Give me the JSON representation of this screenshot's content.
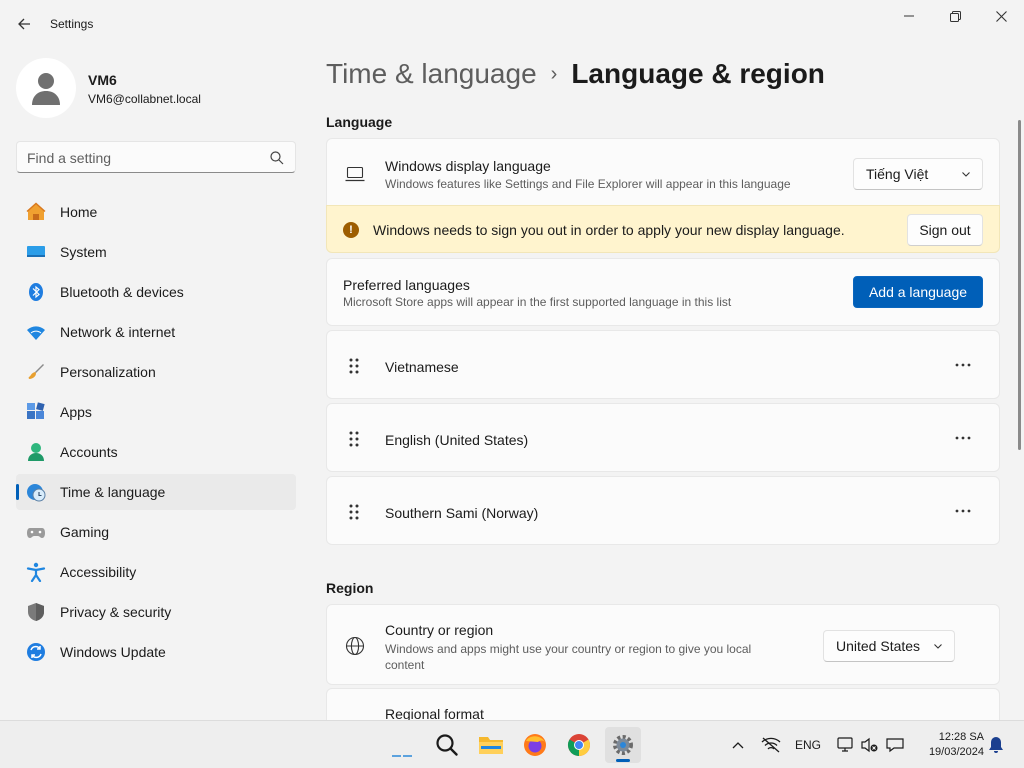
{
  "window": {
    "title": "Settings"
  },
  "profile": {
    "name": "VM6",
    "email": "VM6@collabnet.local"
  },
  "search": {
    "placeholder": "Find a setting"
  },
  "sidebar": {
    "items": [
      {
        "label": "Home",
        "icon": "home-icon"
      },
      {
        "label": "System",
        "icon": "system-icon"
      },
      {
        "label": "Bluetooth & devices",
        "icon": "bluetooth-icon"
      },
      {
        "label": "Network & internet",
        "icon": "wifi-icon"
      },
      {
        "label": "Personalization",
        "icon": "brush-icon"
      },
      {
        "label": "Apps",
        "icon": "apps-icon"
      },
      {
        "label": "Accounts",
        "icon": "accounts-icon"
      },
      {
        "label": "Time & language",
        "icon": "time-language-icon",
        "active": true
      },
      {
        "label": "Gaming",
        "icon": "gamepad-icon"
      },
      {
        "label": "Accessibility",
        "icon": "accessibility-icon"
      },
      {
        "label": "Privacy & security",
        "icon": "shield-icon"
      },
      {
        "label": "Windows Update",
        "icon": "update-icon"
      }
    ]
  },
  "breadcrumb": {
    "parent": "Time & language",
    "current": "Language & region"
  },
  "language": {
    "section_title": "Language",
    "display": {
      "title": "Windows display language",
      "description": "Windows features like Settings and File Explorer will appear in this language",
      "selected": "Tiếng Việt"
    },
    "banner": {
      "text": "Windows needs to sign you out in order to apply your new display language.",
      "button": "Sign out"
    },
    "preferred": {
      "title": "Preferred languages",
      "description": "Microsoft Store apps will appear in the first supported language in this list",
      "add_button": "Add a language"
    },
    "languages": [
      {
        "name": "Vietnamese"
      },
      {
        "name": "English (United States)"
      },
      {
        "name": "Southern Sami (Norway)"
      }
    ]
  },
  "region": {
    "section_title": "Region",
    "country": {
      "title": "Country or region",
      "description": "Windows and apps might use your country or region to give you local content",
      "selected": "United States"
    },
    "format": {
      "title": "Regional format"
    }
  },
  "taskbar": {
    "input_indicator": "ENG",
    "time": "12:28 SA",
    "date": "19/03/2024"
  },
  "colors": {
    "accent": "#005fb8",
    "banner_bg": "#fff4ce",
    "warning_icon": "#9d5d00"
  }
}
